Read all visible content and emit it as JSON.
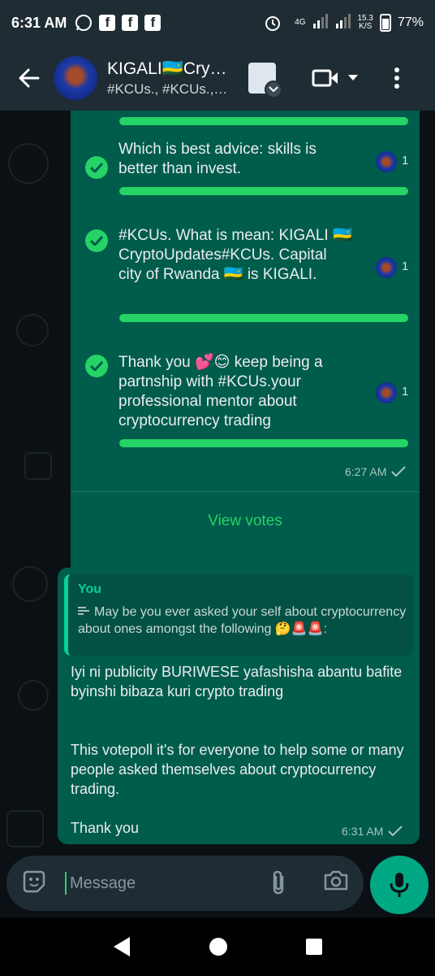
{
  "status_bar": {
    "time": "6:31 AM",
    "network": "4G",
    "speed_value": "15.3",
    "speed_unit": "K/S",
    "battery": "77%"
  },
  "header": {
    "title": "KIGALI🇷🇼Cry…",
    "subtitle": "#KCUs., #KCUs.,…",
    "icons": [
      "back-arrow-icon",
      "video-call-icon",
      "dropdown-icon",
      "more-options-icon"
    ]
  },
  "poll": {
    "options": [
      {
        "text": "Which is best advice: skills is better than invest.",
        "votes": "1",
        "progress": 1.0
      },
      {
        "text": "#KCUs. What is mean: KIGALI 🇷🇼CryptoUpdates#KCUs. Capital city of Rwanda 🇷🇼 is KIGALI.",
        "votes": "1",
        "progress": 1.0
      },
      {
        "text": "Thank you 💕😊 keep being a partnship with #KCUs.your professional mentor about cryptocurrency trading",
        "votes": "1",
        "progress": 1.0
      }
    ],
    "time": "6:27 AM",
    "view_votes_label": "View votes"
  },
  "reply_message": {
    "quote_author": "You",
    "quote_text": "May be you ever asked your self about cryptocurrency about ones amongst the following 🤔🚨🚨:",
    "body": "Iyi ni publicity BURIWESE yafashisha abantu bafite byinshi bibaza kuri crypto trading\n\n\nThis votepoll it's for everyone to help some or many people asked themselves about cryptocurrency trading.\n\nThank you",
    "time": "6:31 AM"
  },
  "composer": {
    "placeholder": "Message"
  },
  "colors": {
    "bubble": "#005c4b",
    "accent": "#25d366",
    "header": "#1f2c33",
    "background": "#0b1014"
  }
}
